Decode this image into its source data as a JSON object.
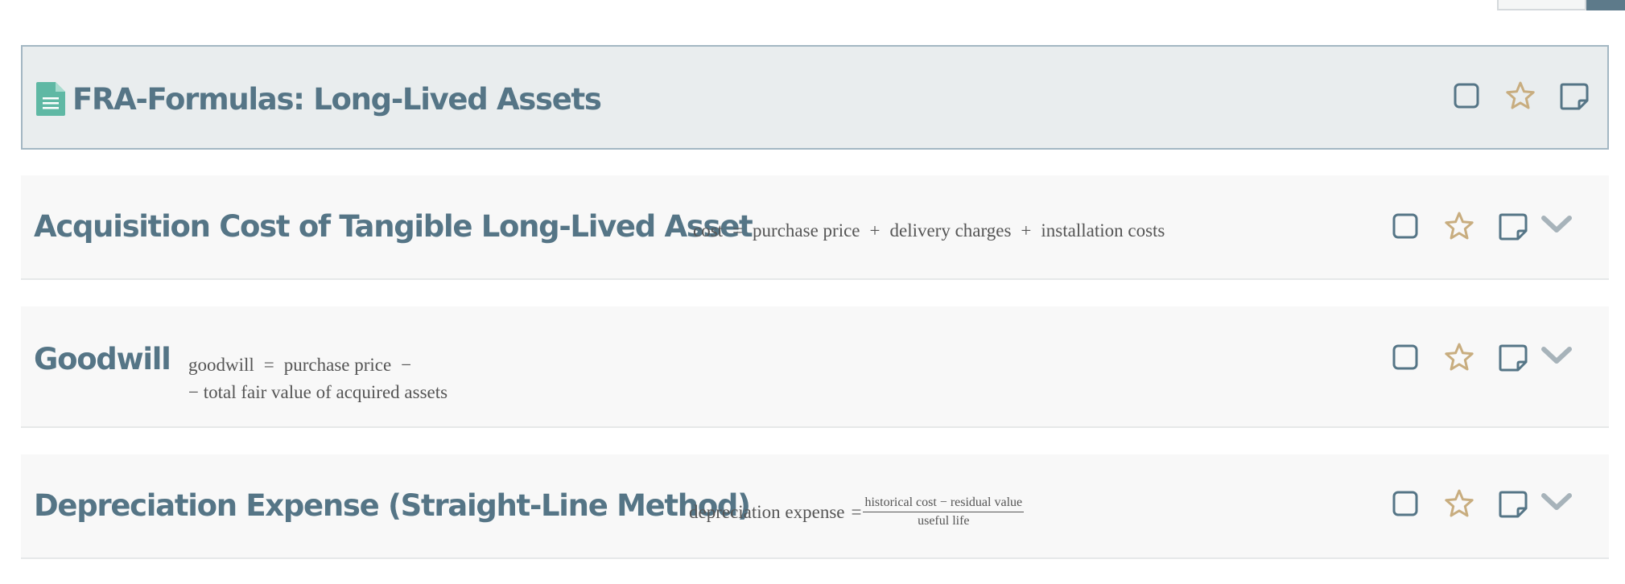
{
  "header": {
    "title": "FRA-Formulas: Long-Lived Assets",
    "icons": [
      "document-icon",
      "checkbox-icon",
      "star-icon",
      "note-icon"
    ]
  },
  "rows": [
    {
      "title": "Acquisition Cost of Tangible Long-Lived Asset",
      "formula": {
        "lhs": "cost",
        "eq": "=",
        "t1": "purchase price",
        "p1": "+",
        "t2": "delivery charges",
        "p2": "+",
        "t3": "installation costs"
      }
    },
    {
      "title": "Goodwill",
      "formula": {
        "lhs": "goodwill",
        "eq": "=",
        "t1": "purchase price",
        "m1": "−",
        "line2": "− total fair value of acquired assets"
      }
    },
    {
      "title": "Depreciation Expense (Straight-Line Method)",
      "formula": {
        "lhs": "depreciation expense",
        "eq": "=",
        "numerator": "historical cost − residual value",
        "denominator": "useful life"
      }
    }
  ],
  "colors": {
    "title": "#557586",
    "icon": "#557586",
    "star": "#c8ad7f",
    "chevron": "#a7b3ba",
    "doc_icon": "#5fb8a4",
    "header_bg": "#e9edee",
    "header_border": "#a3b7c3",
    "row_bg": "#f8f8f8"
  }
}
